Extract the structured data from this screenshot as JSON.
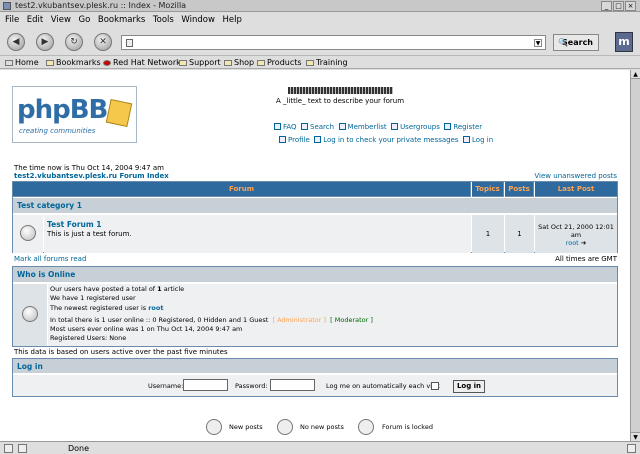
{
  "window": {
    "title": "test2.vkubantsev.plesk.ru :: Index - Mozilla"
  },
  "menu": [
    "File",
    "Edit",
    "View",
    "Go",
    "Bookmarks",
    "Tools",
    "Window",
    "Help"
  ],
  "toolbar": {
    "search_label": "Search",
    "url_value": ""
  },
  "bookmarks": [
    {
      "label": "Home",
      "icon": "home-icon"
    },
    {
      "label": "Bookmarks",
      "icon": "folder-icon"
    },
    {
      "label": "Red Hat Network",
      "icon": "redhat-icon"
    },
    {
      "label": "Support",
      "icon": "folder-icon"
    },
    {
      "label": "Shop",
      "icon": "folder-icon"
    },
    {
      "label": "Products",
      "icon": "folder-icon"
    },
    {
      "label": "Training",
      "icon": "folder-icon"
    }
  ],
  "header": {
    "logo_text": "phpBB",
    "logo_tagline": "creating communities",
    "site_description": "A _little_ text to describe your forum",
    "nav_row1": [
      "FAQ",
      "Search",
      "Memberlist",
      "Usergroups",
      "Register"
    ],
    "nav_row2": [
      "Profile",
      "Log in to check your private messages",
      "Log in"
    ]
  },
  "info": {
    "time_text": "The time now is Thu Oct 14, 2004 9:47 am",
    "forum_index": "test2.vkubantsev.plesk.ru Forum Index",
    "unanswered": "View unanswered posts"
  },
  "forum_table": {
    "headers": [
      "Forum",
      "Topics",
      "Posts",
      "Last Post"
    ],
    "category": "Test category 1",
    "forum": {
      "name": "Test Forum 1",
      "description": "This is just a test forum.",
      "topics": "1",
      "posts": "1",
      "last_post_date": "Sat Oct 21, 2000 12:01 am",
      "last_post_user": "root"
    }
  },
  "below_table": {
    "mark_read": "Mark all forums read",
    "timezone": "All times are GMT"
  },
  "who_is_online": {
    "title": "Who is Online",
    "line1_pre": "Our users have posted a total of ",
    "line1_num": "1",
    "line1_post": " article",
    "line2": "We have 1 registered user",
    "line3_pre": "The newest registered user is ",
    "line3_user": "root",
    "line4_pre": "In total there is 1 user online :: 0 Registered, 0 Hidden and 1 Guest",
    "line4_admin": "[ Administrator ]",
    "line4_mod": "[ Moderator ]",
    "line5": "Most users ever online was 1 on Thu Oct 14, 2004 9:47 am",
    "line6": "Registered Users: None",
    "based_on": "This data is based on users active over the past five minutes"
  },
  "login": {
    "title": "Log in",
    "username_label": "Username:",
    "password_label": "Password:",
    "auto_label": "Log me on automatically each visit",
    "button": "Log in"
  },
  "legend": [
    "New posts",
    "No new posts",
    "Forum is locked"
  ],
  "status": {
    "text": "Done"
  },
  "colors": {
    "header_bar": "#2f6a9f",
    "header_text": "#ffa34f",
    "category_bg": "#c7d0d7",
    "link": "#006699",
    "admin": "#ffa34f",
    "moderator": "#006600"
  }
}
